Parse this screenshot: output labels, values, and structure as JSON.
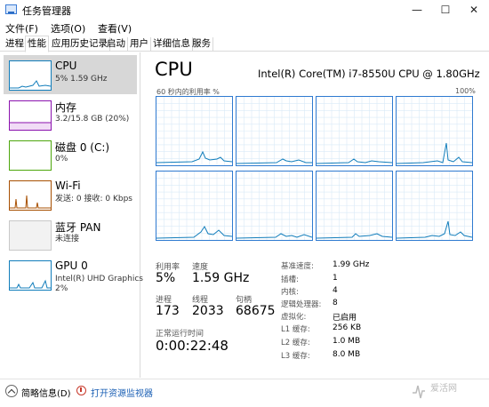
{
  "window": {
    "title": "任务管理器",
    "min_glyph": "—",
    "max_glyph": "☐",
    "close_glyph": "✕"
  },
  "menu": [
    "文件(F)",
    "选项(O)",
    "查看(V)"
  ],
  "tabs": [
    "进程",
    "性能",
    "应用历史记录",
    "启动",
    "用户",
    "详细信息",
    "服务"
  ],
  "active_tab": "性能",
  "sidebar": [
    {
      "name": "CPU",
      "sub": "5% 1.59 GHz",
      "color": "#117dbb",
      "selected": true
    },
    {
      "name": "内存",
      "sub": "3.2/15.8 GB (20%)",
      "color": "#8b12ae",
      "selected": false
    },
    {
      "name": "磁盘 0 (C:)",
      "sub": "0%",
      "color": "#4da60c",
      "selected": false
    },
    {
      "name": "Wi-Fi",
      "sub": "发送: 0 接收: 0 Kbps",
      "color": "#a74f01",
      "selected": false
    },
    {
      "name": "蓝牙 PAN",
      "sub": "未连接",
      "color": "#a0a0a0",
      "selected": false
    },
    {
      "name": "GPU 0",
      "sub": "Intel(R) UHD Graphics",
      "sub2": "2%",
      "color": "#117dbb",
      "selected": false
    }
  ],
  "cpu": {
    "title": "CPU",
    "model": "Intel(R) Core(TM) i7-8550U CPU @ 1.80GHz",
    "graph_label": "60 秒内的利用率 %",
    "graph_max": "100%",
    "graph_color": "#117dbb",
    "grid_color": "#d9eaf7"
  },
  "stats": {
    "util_label": "利用率",
    "util_value": "5%",
    "speed_label": "速度",
    "speed_value": "1.59 GHz",
    "proc_label": "进程",
    "proc_value": "173",
    "thread_label": "线程",
    "thread_value": "2033",
    "handle_label": "句柄",
    "handle_value": "68675",
    "uptime_label": "正常运行时间",
    "uptime_value": "0:00:22:48"
  },
  "specs": [
    {
      "label": "基准速度:",
      "value": "1.99 GHz"
    },
    {
      "label": "插槽:",
      "value": "1"
    },
    {
      "label": "内核:",
      "value": "4"
    },
    {
      "label": "逻辑处理器:",
      "value": "8"
    },
    {
      "label": "虚拟化:",
      "value": "已启用"
    },
    {
      "label": "L1 缓存:",
      "value": "256 KB"
    },
    {
      "label": "L2 缓存:",
      "value": "1.0 MB"
    },
    {
      "label": "L3 缓存:",
      "value": "8.0 MB"
    }
  ],
  "bottom": {
    "fewer_details": "简略信息(D)",
    "open_monitor": "打开资源监视器"
  },
  "watermark": "爱活网"
}
